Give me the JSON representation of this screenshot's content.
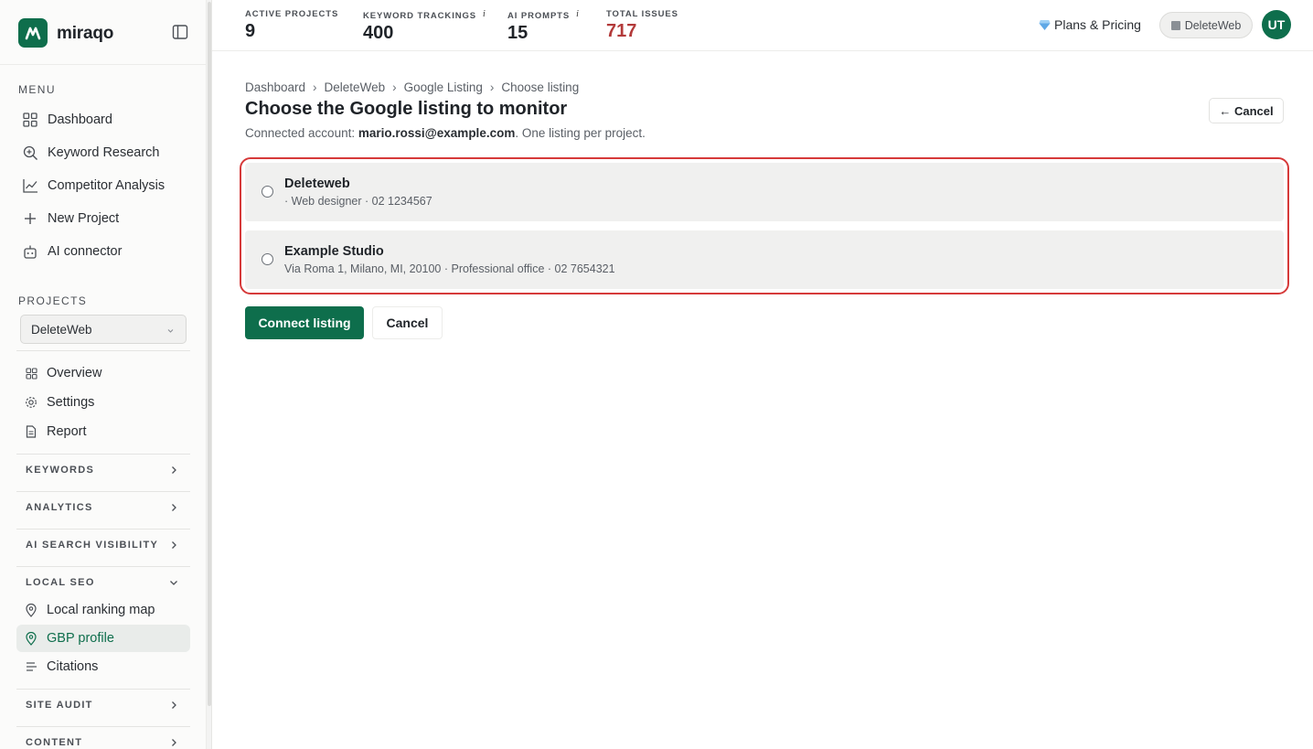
{
  "app": {
    "brand": "miraqo"
  },
  "sidebar": {
    "menu_label": "MENU",
    "menu": [
      {
        "label": "Dashboard",
        "icon": "grid-icon"
      },
      {
        "label": "Keyword Research",
        "icon": "search-plus-icon"
      },
      {
        "label": "Competitor Analysis",
        "icon": "line-chart-icon"
      },
      {
        "label": "New Project",
        "icon": "plus-icon"
      },
      {
        "label": "AI connector",
        "icon": "robot-icon"
      }
    ],
    "projects_label": "PROJECTS",
    "project_selected": "DeleteWeb",
    "project_menu": [
      {
        "label": "Overview",
        "icon": "grid-small-icon"
      },
      {
        "label": "Settings",
        "icon": "gear-icon"
      },
      {
        "label": "Report",
        "icon": "document-icon"
      }
    ],
    "groups": {
      "keywords": "KEYWORDS",
      "analytics": "ANALYTICS",
      "ai_search": "AI SEARCH VISIBILITY",
      "local_seo": "LOCAL SEO",
      "site_audit": "SITE AUDIT",
      "content": "CONTENT"
    },
    "local_seo_items": [
      {
        "label": "Local ranking map",
        "icon": "map-pin-icon"
      },
      {
        "label": "GBP profile",
        "icon": "map-pin-icon",
        "active": true
      },
      {
        "label": "Citations",
        "icon": "list-icon"
      }
    ]
  },
  "topbar": {
    "stats": [
      {
        "label": "ACTIVE PROJECTS",
        "value": "9",
        "info": false
      },
      {
        "label": "KEYWORD TRACKINGS",
        "value": "400",
        "info": true
      },
      {
        "label": "AI PROMPTS",
        "value": "15",
        "info": true
      },
      {
        "label": "TOTAL ISSUES",
        "value": "717",
        "info": false
      }
    ],
    "info_glyph": "i",
    "plans_label": "Plans & Pricing",
    "workspace": "DeleteWeb",
    "avatar_initials": "UT"
  },
  "main": {
    "breadcrumb": [
      "Dashboard",
      "DeleteWeb",
      "Google Listing",
      "Choose listing"
    ],
    "breadcrumb_sep": "›",
    "title": "Choose the Google listing to monitor",
    "subtitle_prefix": "Connected account: ",
    "account_email": "mario.rossi@example.com",
    "subtitle_suffix": ". One listing per project.",
    "cancel_top": "← Cancel",
    "listings": [
      {
        "name": "Deleteweb",
        "meta": "· Web designer · 02 1234567"
      },
      {
        "name": "Example Studio",
        "meta": "Via Roma 1, Milano, MI, 20100 · Professional office · 02 7654321"
      }
    ],
    "connect_label": "Connect listing",
    "cancel_label": "Cancel"
  },
  "colors": {
    "brand_green": "#0e6e4c",
    "issues_red": "#b33a3a",
    "highlight_red": "#d63a3a"
  }
}
